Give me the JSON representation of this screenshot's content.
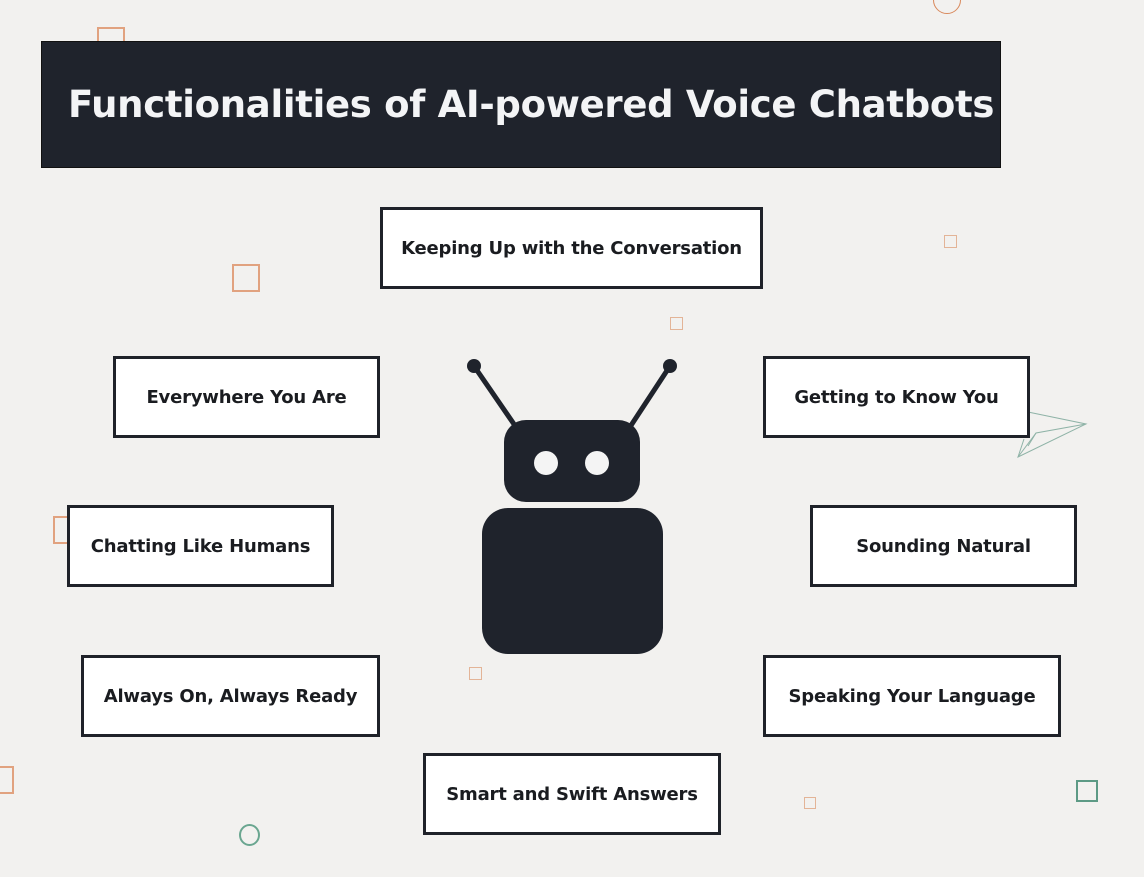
{
  "header": {
    "title": "Functionalities of AI-powered Voice Chatbots"
  },
  "features": [
    {
      "id": "keeping-up",
      "label": "Keeping Up with the Conversation"
    },
    {
      "id": "everywhere",
      "label": "Everywhere You Are"
    },
    {
      "id": "getting-to-know",
      "label": "Getting to Know You"
    },
    {
      "id": "chatting-like-humans",
      "label": "Chatting Like Humans"
    },
    {
      "id": "sounding-natural",
      "label": "Sounding Natural"
    },
    {
      "id": "always-on",
      "label": "Always On, Always Ready"
    },
    {
      "id": "speaking-language",
      "label": "Speaking Your Language"
    },
    {
      "id": "smart-swift",
      "label": "Smart and Swift Answers"
    }
  ],
  "center_icon": "robot-icon",
  "colors": {
    "background": "#f2f1ef",
    "banner": "#1f232c",
    "banner_text": "#f3f4f6",
    "box_border": "#1f2229",
    "robot": "#1f232c",
    "accent_orange": "#e1a27f",
    "accent_green": "#5d9a85"
  }
}
